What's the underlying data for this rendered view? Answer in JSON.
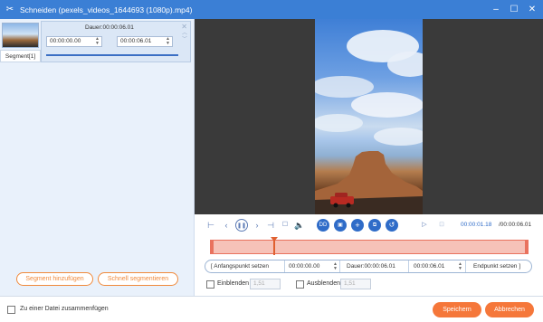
{
  "window": {
    "title": "Schneiden (pexels_videos_1644693 (1080p).mp4)",
    "app_icon": "scissors-icon",
    "controls": [
      "minimize-icon",
      "maximize-icon",
      "close-icon"
    ]
  },
  "segment": {
    "label": "Segment[1]",
    "duration": "Dauer:00:00:06.01",
    "start": "00:00:00.00",
    "dash": "–",
    "end": "00:00:06.01"
  },
  "left_buttons": {
    "add": "Segment hinzufügen",
    "quick": "Schnell segmentieren"
  },
  "player": {
    "time_current": "00:00:01.18",
    "time_total": "/00:00:06.01",
    "icons": [
      "trim-start-icon",
      "prev-frame-icon",
      "pause-icon",
      "next-frame-icon",
      "trim-end-icon",
      "stop-icon",
      "volume-icon",
      "split-icon",
      "copy-icon",
      "add-icon",
      "duplicate-icon",
      "reset-icon",
      "play-from-start-icon",
      "clip-icon"
    ],
    "icon_glyphs": {
      "split": "DD"
    }
  },
  "timeline": {
    "playhead_fraction": 0.196
  },
  "trim": {
    "set_start": "Anfangspunkt setzen",
    "start": "00:00:00.00",
    "duration": "Dauer:00:00:06.01",
    "end": "00:00:06.01",
    "set_end": "Endpunkt setzen"
  },
  "fade": {
    "fade_in_label": "Einblenden",
    "fade_in_value": "1,51",
    "fade_out_label": "Ausblenden",
    "fade_out_value": "1,51"
  },
  "footer": {
    "merge_label": "Zu einer Datei zusammenfügen",
    "save": "Speichern",
    "cancel": "Abbrechen"
  },
  "colors": {
    "titlebar": "#3b7fd5",
    "accent_orange": "#f5773a",
    "control_blue": "#2f6cc8",
    "timeline_fill": "#f6c2b8"
  }
}
